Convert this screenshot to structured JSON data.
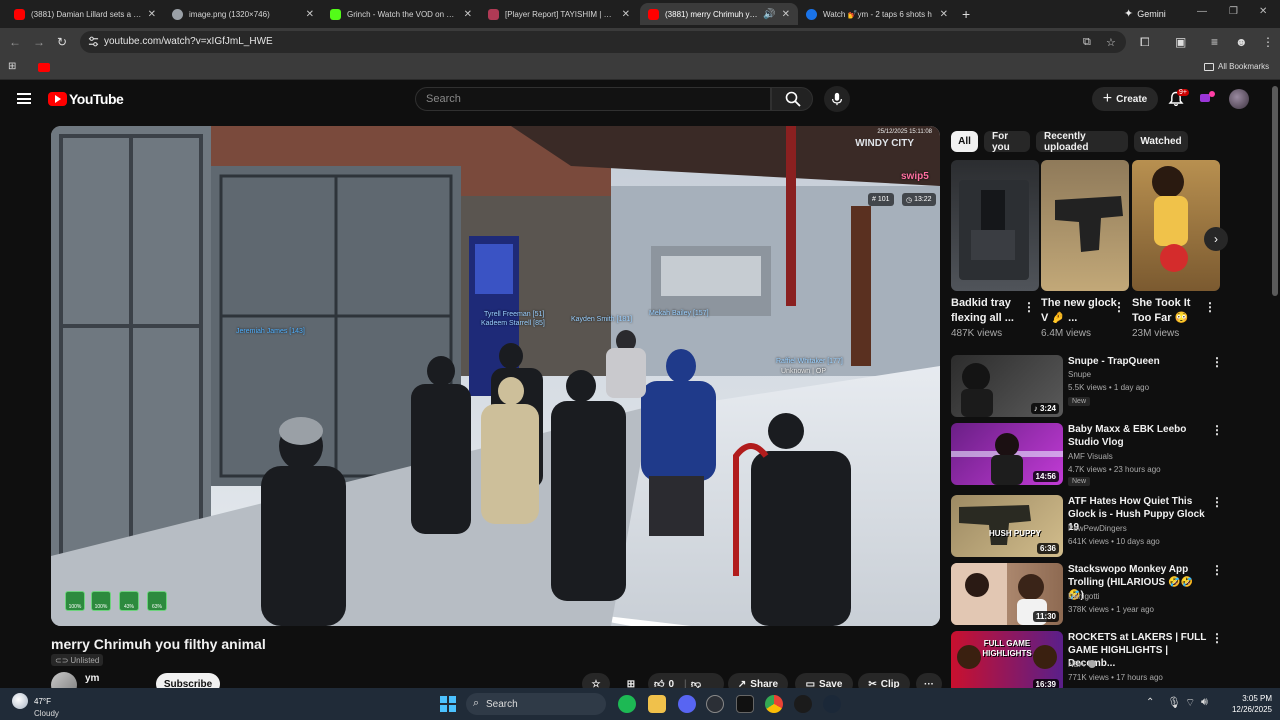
{
  "browser": {
    "tabs": [
      {
        "title": "(3881) Damian Lillard sets a NE",
        "favicon_color": "#ff0000"
      },
      {
        "title": "image.png (1320×746)",
        "favicon_color": "#9aa0a6"
      },
      {
        "title": "Grinch - Watch the VOD on Kick",
        "favicon_color": "#53fc18"
      },
      {
        "title": "[Player Report] TAYISHIM | Wind",
        "favicon_color": "#b03a55"
      },
      {
        "title": "(3881) merry Chrimuh you f",
        "favicon_color": "#ff0000"
      },
      {
        "title": "Watch 💅ym - 2 taps 6 shots h",
        "favicon_color": "#1a73e8"
      }
    ],
    "active_tab": 4,
    "new_tab": "+",
    "gemini_label": "Gemini",
    "url": "youtube.com/watch?v=xIGfJmL_HWE",
    "all_bookmarks": "All Bookmarks"
  },
  "youtube": {
    "logo_text": "YouTube",
    "search_placeholder": "Search",
    "create_label": "Create",
    "notifications_badge": "9+",
    "video": {
      "title": "merry Chrimuh you filthy animal",
      "visibility": "Unlisted",
      "channel": "ym",
      "subscribe_label": "Subscribe",
      "like_count": "0",
      "share_label": "Share",
      "save_label": "Save",
      "clip_label": "Clip",
      "overlay": {
        "server_name": "WINDY CITY",
        "streamer_tag": "swip5",
        "player_count": "101",
        "game_time": "13:22",
        "timestamp": "25/12/2025 15:11:08",
        "nametags": [
          {
            "text": "Tyrell Freeman [51]",
            "color": "#9ad0ff"
          },
          {
            "text": "Kadeem Starrell [85]",
            "color": "#9ad0ff"
          },
          {
            "text": "Kayden Smith [181]",
            "color": "#9ad0ff"
          },
          {
            "text": "Jeremiah James [143]",
            "color": "#4fb0ff"
          },
          {
            "text": "Raffiel Whitaker [177]",
            "color": "#9ad0ff"
          },
          {
            "text": "Mekah Bailey [157]",
            "color": "#9ad0ff"
          },
          {
            "text": "Unknown | OP",
            "color": "#dddddd"
          }
        ],
        "hud": [
          "100%",
          "100%",
          "43%",
          "63%"
        ]
      }
    },
    "chips": [
      "All",
      "For you",
      "Recently uploaded",
      "Watched"
    ],
    "shorts": [
      {
        "title": "Badkid tray flexing all ...",
        "views": "487K views"
      },
      {
        "title": "The new glock V 🤌 ...",
        "views": "6.4M views"
      },
      {
        "title": "She Took It Too Far 😳",
        "views": "23M views"
      }
    ],
    "recommendations": [
      {
        "title": "Snupe - TrapQueen",
        "channel": "Snupe",
        "meta": "5.5K views • 1 day ago",
        "duration": "3:24",
        "badge": "New",
        "shorts_icon": "♪"
      },
      {
        "title": "Baby Maxx & EBK Leebo Studio Vlog",
        "channel": "AMF Visuals",
        "meta": "4.7K views • 23 hours ago",
        "duration": "14:56",
        "badge": "New"
      },
      {
        "title": "ATF Hates How Quiet This Glock is - Hush Puppy  Glock 19",
        "channel": "PewPewDingers",
        "meta": "641K views • 10 days ago",
        "duration": "6:36",
        "thumb_text": "HUSH PUPPY"
      },
      {
        "title": "Stackswopo Monkey App Trolling (HILARIOUS 🤣🤣🤣)",
        "channel": "Danigotti",
        "meta": "378K views • 1 year ago",
        "duration": "11:30"
      },
      {
        "title": "ROCKETS at LAKERS | FULL GAME HIGHLIGHTS | Decemb...",
        "channel": "NBA",
        "meta": "771K views • 17 hours ago",
        "duration": "16:39",
        "thumb_text": "FULL GAME HIGHLIGHTS"
      }
    ]
  },
  "taskbar": {
    "temp": "47°F",
    "condition": "Cloudy",
    "search_label": "Search",
    "time": "3:05 PM",
    "date": "12/26/2025"
  },
  "colors": {
    "yt_bg": "#0f0f0f",
    "yt_red": "#ff0000",
    "chip_bg": "#272727",
    "taskbar": "#202b38"
  }
}
